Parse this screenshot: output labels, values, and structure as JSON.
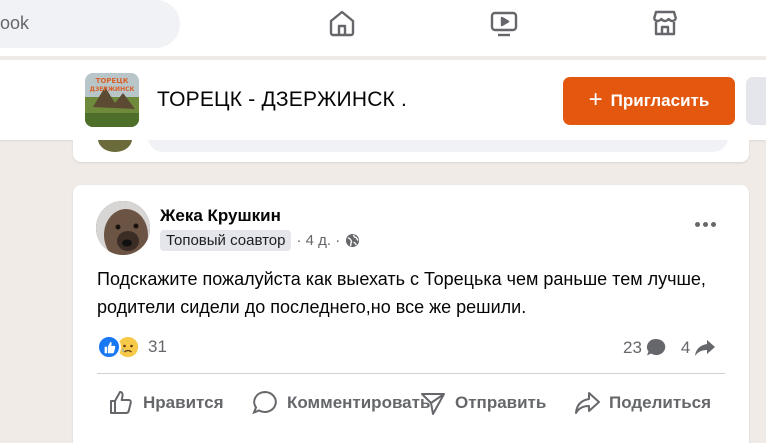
{
  "topnav": {
    "search_text": "ook",
    "icons": [
      "home-icon",
      "video-icon",
      "marketplace-icon"
    ]
  },
  "group": {
    "title": "ТОРЕЦК - ДЗЕРЖИНСК .",
    "thumb_text_line1": "ТОРЕЦК",
    "thumb_text_line2": "ДЗЕРЖИНСК",
    "invite_label": "Пригласить",
    "accent_color": "#e4570f"
  },
  "post": {
    "author": "Жека Крушкин",
    "badge": "Топовый соавтор",
    "time": "· 4 д. ·",
    "text": "Подскажите пожалуйста как выехать с Торецька чем раньше тем лучше, родители сидели до последнего,но все же решили.",
    "reactions_count": "31",
    "comments_count": "23",
    "shares_count": "4",
    "actions": {
      "like": "Нравится",
      "comment": "Комментировать",
      "send": "Отправить",
      "share": "Поделиться"
    }
  }
}
